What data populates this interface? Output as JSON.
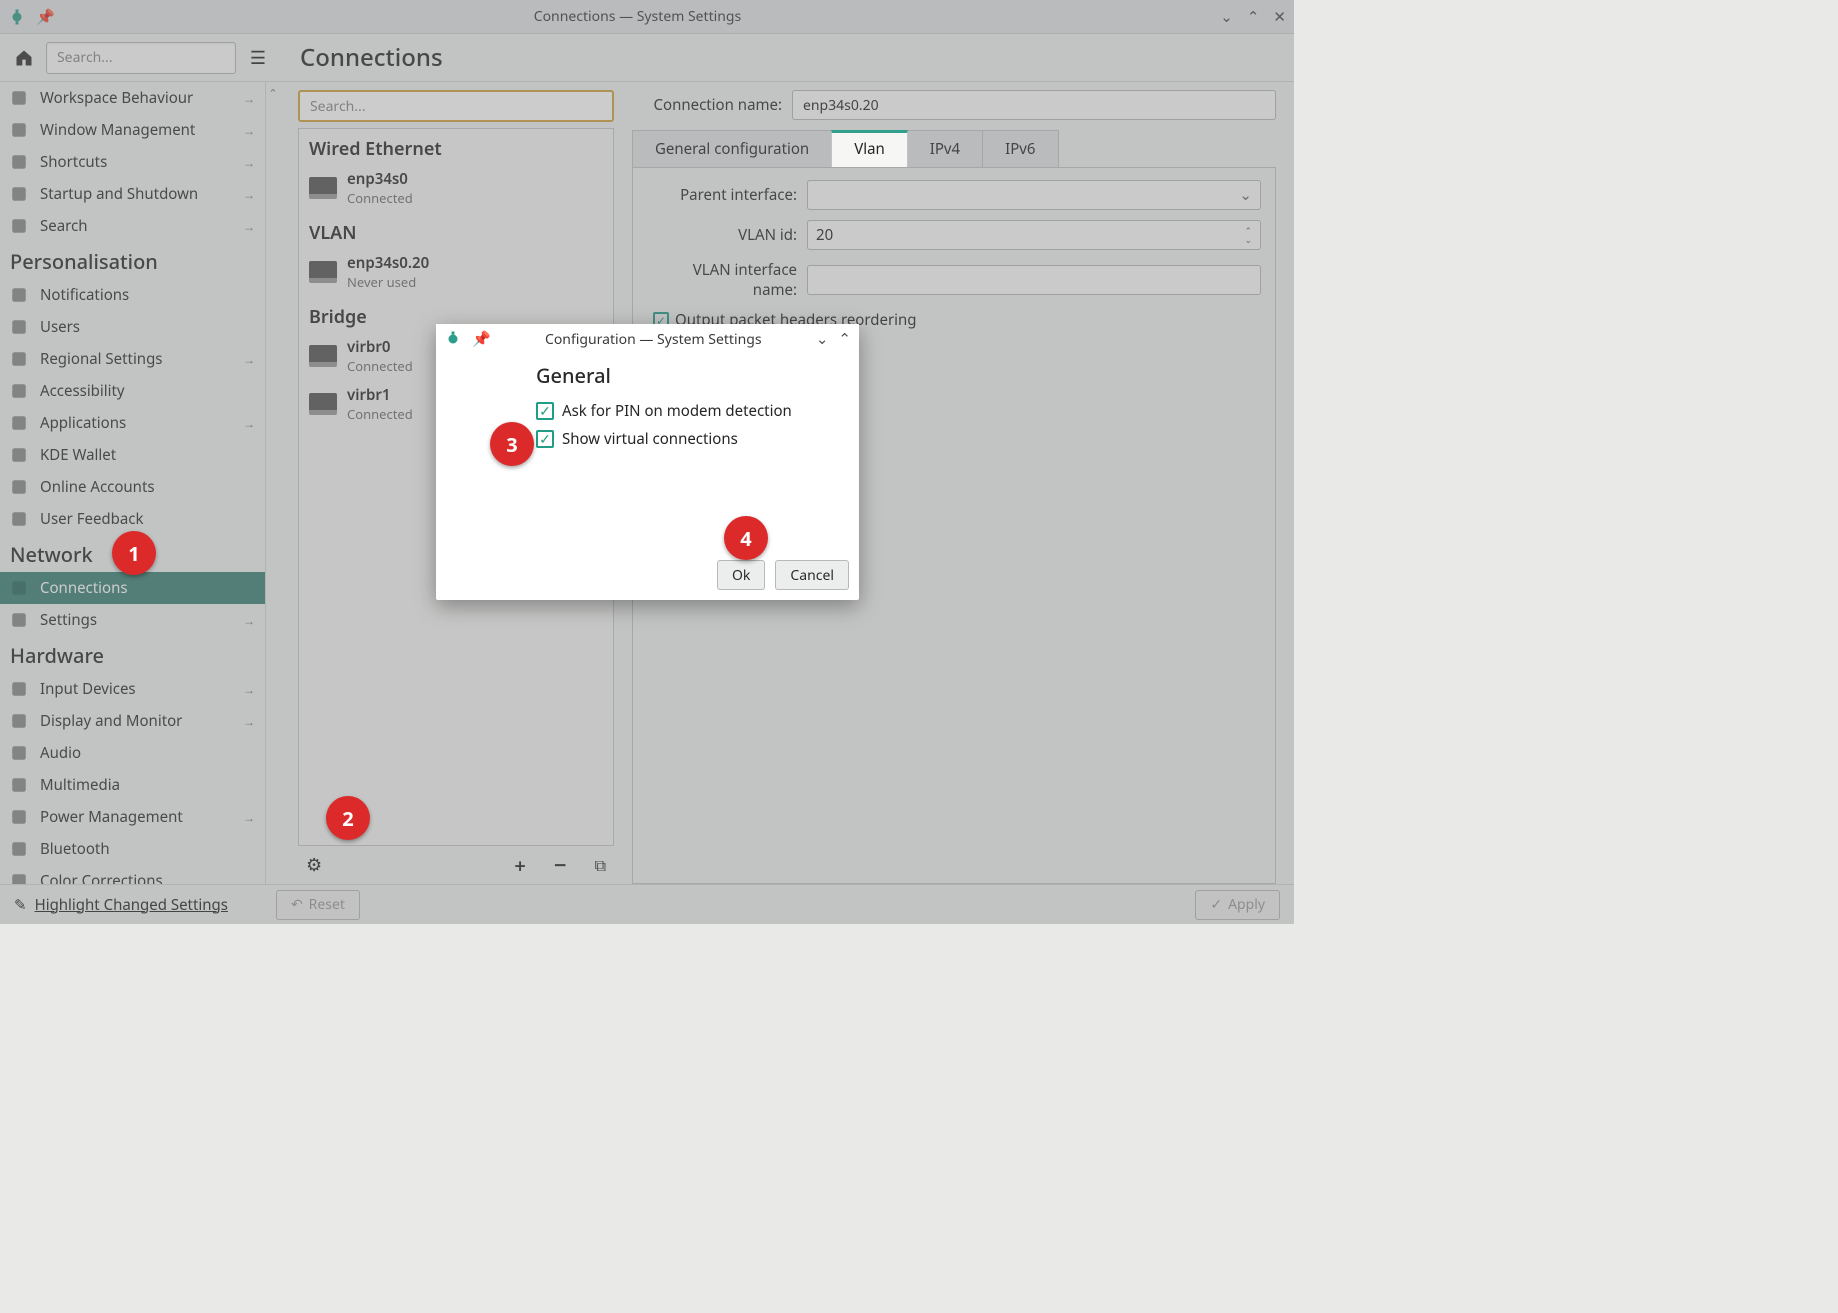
{
  "window": {
    "title": "Connections — System Settings"
  },
  "toolbar": {
    "search_placeholder": "Search...",
    "page_title": "Connections"
  },
  "sidebar": {
    "groups": [
      {
        "items": [
          {
            "label": "Workspace Behaviour",
            "has_sub": true,
            "icon": "workspace"
          },
          {
            "label": "Window Management",
            "has_sub": true,
            "icon": "window"
          },
          {
            "label": "Shortcuts",
            "has_sub": true,
            "icon": "keyboard"
          },
          {
            "label": "Startup and Shutdown",
            "has_sub": true,
            "icon": "power"
          },
          {
            "label": "Search",
            "has_sub": true,
            "icon": "search"
          }
        ]
      },
      {
        "title": "Personalisation",
        "items": [
          {
            "label": "Notifications",
            "icon": "bell"
          },
          {
            "label": "Users",
            "icon": "user"
          },
          {
            "label": "Regional Settings",
            "has_sub": true,
            "icon": "region"
          },
          {
            "label": "Accessibility",
            "icon": "access"
          },
          {
            "label": "Applications",
            "has_sub": true,
            "icon": "apps"
          },
          {
            "label": "KDE Wallet",
            "icon": "wallet"
          },
          {
            "label": "Online Accounts",
            "icon": "cloud"
          },
          {
            "label": "User Feedback",
            "icon": "feedback"
          }
        ]
      },
      {
        "title": "Network",
        "items": [
          {
            "label": "Connections",
            "active": true,
            "icon": "net"
          },
          {
            "label": "Settings",
            "has_sub": true,
            "icon": "net-settings"
          }
        ]
      },
      {
        "title": "Hardware",
        "items": [
          {
            "label": "Input Devices",
            "has_sub": true,
            "icon": "mouse"
          },
          {
            "label": "Display and Monitor",
            "has_sub": true,
            "icon": "display"
          },
          {
            "label": "Audio",
            "icon": "audio"
          },
          {
            "label": "Multimedia",
            "icon": "media"
          },
          {
            "label": "Power Management",
            "has_sub": true,
            "icon": "battery"
          },
          {
            "label": "Bluetooth",
            "icon": "bt"
          },
          {
            "label": "Color Corrections",
            "icon": "color"
          }
        ]
      }
    ]
  },
  "connections": {
    "search_placeholder": "Search...",
    "groups": [
      {
        "title": "Wired Ethernet",
        "items": [
          {
            "name": "enp34s0",
            "status": "Connected"
          }
        ]
      },
      {
        "title": "VLAN",
        "items": [
          {
            "name": "enp34s0.20",
            "status": "Never used"
          }
        ]
      },
      {
        "title": "Bridge",
        "items": [
          {
            "name": "virbr0",
            "status": "Connected"
          },
          {
            "name": "virbr1",
            "status": "Connected"
          }
        ]
      }
    ]
  },
  "detail": {
    "conn_name_label": "Connection name:",
    "conn_name_value": "enp34s0.20",
    "tabs": [
      "General configuration",
      "Vlan",
      "IPv4",
      "IPv6"
    ],
    "active_tab": "Vlan",
    "fields": {
      "parent_label": "Parent interface:",
      "parent_value": "",
      "vlan_id_label": "VLAN id:",
      "vlan_id_value": "20",
      "vlan_if_label": "VLAN interface name:",
      "vlan_if_value": "",
      "reorder_label": "Output packet headers reordering",
      "reorder_checked": true
    }
  },
  "footer": {
    "highlight_label": "Highlight Changed Settings",
    "reset_label": "Reset",
    "apply_label": "Apply"
  },
  "modal": {
    "title": "Configuration — System Settings",
    "heading": "General",
    "opt1_label": "Ask for PIN on modem detection",
    "opt1_checked": true,
    "opt2_label": "Show virtual connections",
    "opt2_checked": true,
    "ok_label": "Ok",
    "cancel_label": "Cancel"
  },
  "annotations": [
    "1",
    "2",
    "3",
    "4"
  ]
}
